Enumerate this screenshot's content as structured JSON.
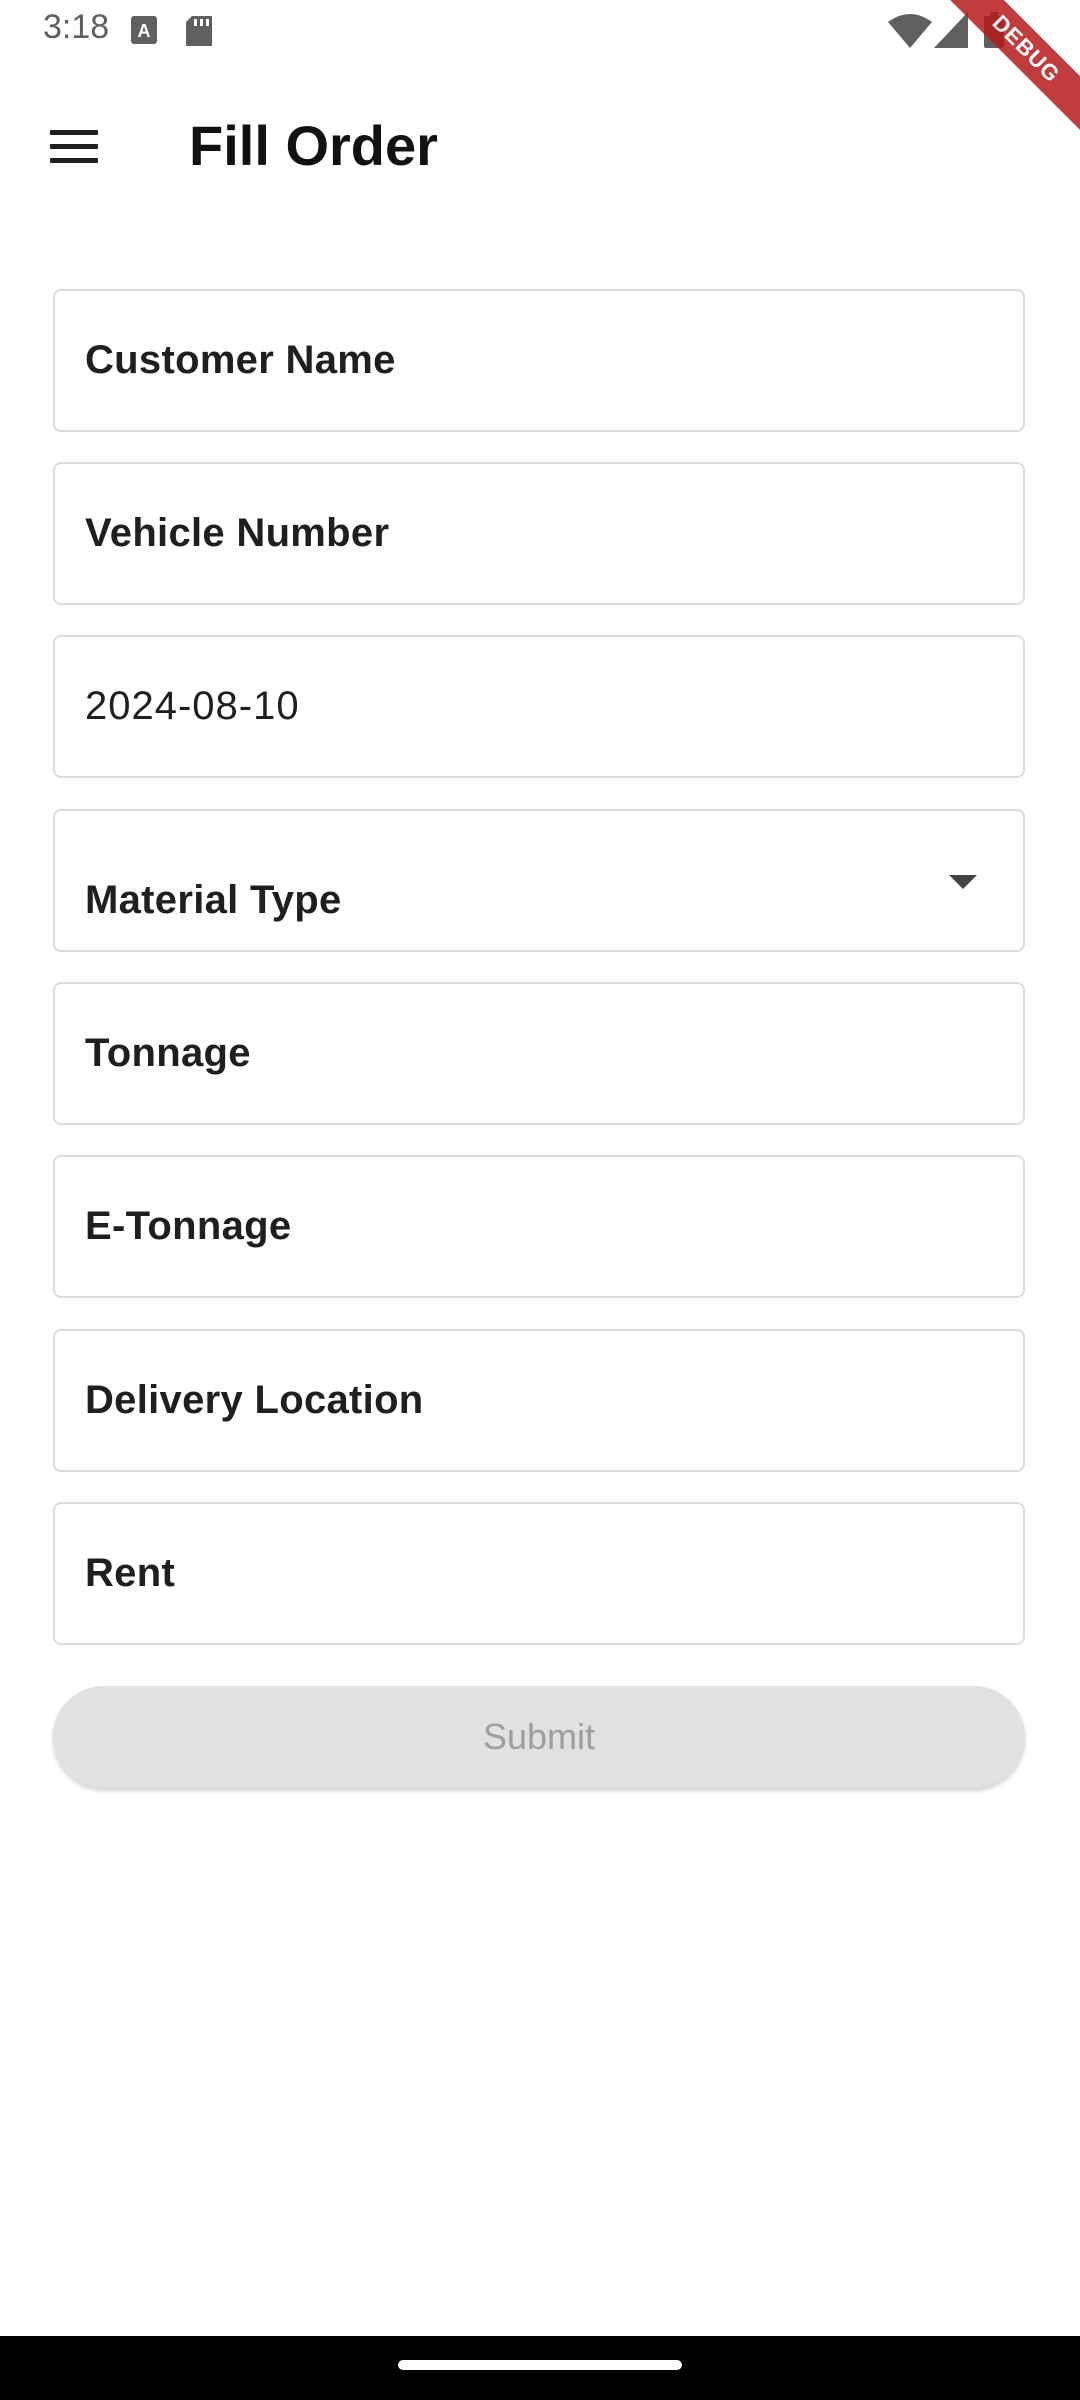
{
  "status_bar": {
    "time": "3:18",
    "icons": [
      "a-notification-icon",
      "sd-card-icon",
      "wifi-icon",
      "signal-icon",
      "battery-icon"
    ]
  },
  "debug_banner": {
    "label": "DEBUG",
    "color": "#b71c1c"
  },
  "app_bar": {
    "menu_icon": "menu-icon",
    "title": "Fill Order"
  },
  "form": {
    "customer_name": {
      "placeholder": "Customer Name",
      "value": ""
    },
    "vehicle_number": {
      "placeholder": "Vehicle Number",
      "value": ""
    },
    "date": {
      "value": "2024-08-10"
    },
    "material_type": {
      "placeholder": "Material Type",
      "selected": ""
    },
    "tonnage": {
      "placeholder": "Tonnage",
      "value": ""
    },
    "e_tonnage": {
      "placeholder": "E-Tonnage",
      "value": ""
    },
    "delivery_location": {
      "placeholder": "Delivery Location",
      "value": ""
    },
    "rent": {
      "placeholder": "Rent",
      "value": ""
    },
    "submit_label": "Submit",
    "submit_enabled": false
  },
  "colors": {
    "field_border": "#dcdcdc",
    "button_disabled_bg": "#e1e1e1",
    "button_disabled_text": "#9e9e9e"
  }
}
